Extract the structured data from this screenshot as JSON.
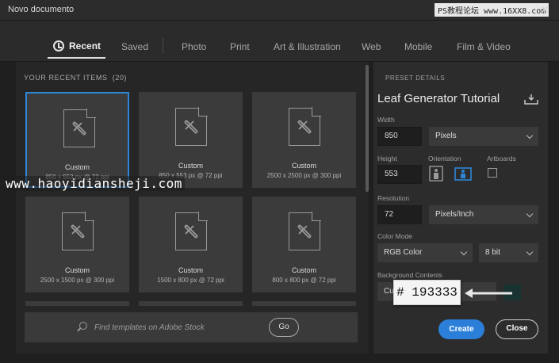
{
  "window": {
    "title": "Novo documento",
    "watermark": "PS教程论坛 www.16XX8.com"
  },
  "tabs": [
    {
      "label": "Recent"
    },
    {
      "label": "Saved"
    },
    {
      "label": "Photo"
    },
    {
      "label": "Print"
    },
    {
      "label": "Art & Illustration"
    },
    {
      "label": "Web"
    },
    {
      "label": "Mobile"
    },
    {
      "label": "Film & Video"
    }
  ],
  "recent": {
    "header": "YOUR RECENT ITEMS",
    "count": "(20)",
    "items": [
      {
        "name": "Custom",
        "dims": "850 x 553 px @ 72 ppi"
      },
      {
        "name": "Custom",
        "dims": "850 x 553 px @ 72 ppi"
      },
      {
        "name": "Custom",
        "dims": "2500 x 2500 px @ 300 ppi"
      },
      {
        "name": "Custom",
        "dims": "2500 x 1500 px @ 300 ppi"
      },
      {
        "name": "Custom",
        "dims": "1500 x 800 px @ 72 ppi"
      },
      {
        "name": "Custom",
        "dims": "800 x 800 px @ 72 ppi"
      }
    ]
  },
  "overlay_url": "www.haoyidiansheji.com",
  "search": {
    "placeholder": "Find templates on Adobe Stock",
    "go_label": "Go"
  },
  "preset": {
    "header": "PRESET DETAILS",
    "name": "Leaf Generator Tutorial",
    "width_label": "Width",
    "width_value": "850",
    "width_unit": "Pixels",
    "height_label": "Height",
    "height_value": "553",
    "orientation_label": "Orientation",
    "artboards_label": "Artboards",
    "resolution_label": "Resolution",
    "resolution_value": "72",
    "resolution_unit": "Pixels/Inch",
    "color_mode_label": "Color Mode",
    "color_mode_value": "RGB Color",
    "bit_depth": "8 bit",
    "background_label": "Background Contents",
    "background_value": "Cu",
    "background_color": "#193333"
  },
  "annotation_hex": "# 193333",
  "buttons": {
    "create": "Create",
    "close": "Close"
  },
  "colors": {
    "accent": "#2b7fd8",
    "swatch": "#193333"
  }
}
